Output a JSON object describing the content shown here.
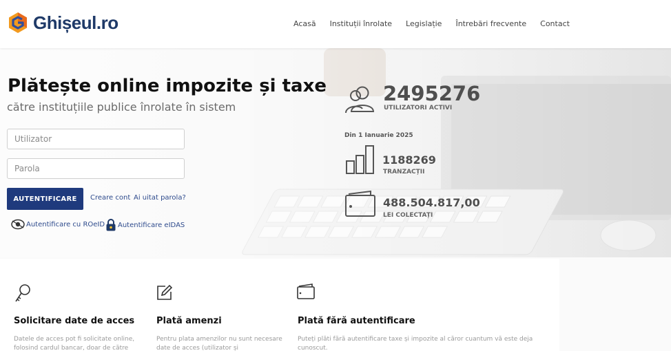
{
  "header": {
    "logo_text": "Ghișeul.ro",
    "nav": [
      "Acasă",
      "Instituții înrolate",
      "Legislație",
      "Întrebări frecvente",
      "Contact"
    ]
  },
  "hero": {
    "title": "Plătește online impozite și taxe",
    "subtitle": "către instituțiile publice înrolate în sistem"
  },
  "login": {
    "user_placeholder": "Utilizator",
    "password_placeholder": "Parola",
    "button_label": "AUTENTIFICARE",
    "create_account": "Creare cont",
    "forgot_password": "Ai uitat parola?",
    "roeid_label": "Autentificare cu ROeID",
    "eidas_label": "Autentificare eIDAS"
  },
  "stats": {
    "users_value": "2495276",
    "users_label": "UTILIZATORI ACTIVI",
    "since_label": "Din 1 Ianuarie 2025",
    "transactions_value": "1188269",
    "transactions_label": "TRANZACȚII",
    "collected_value": "488.504.817,00",
    "collected_label": "LEI COLECTAȚI"
  },
  "cards": [
    {
      "icon": "key-icon",
      "title": "Solicitare date de acces",
      "text": "Datele de acces pot fi solicitate online, folosind cardul bancar, doar de către"
    },
    {
      "icon": "edit-icon",
      "title": "Plată amenzi",
      "text": "Pentru plata amenzilor nu sunt necesare date de acces (utilizator și"
    },
    {
      "icon": "wallet-icon",
      "title": "Plată fără autentificare",
      "text": "Puteți plăti fără autentificare taxe și impozite al căror cuantum vă este deja cunoscut."
    }
  ],
  "colors": {
    "brand_navy": "#1f3a68",
    "button_blue": "#1f3a7d",
    "logo_orange": "#f29a1f",
    "logo_blue": "#2f4f9e"
  }
}
